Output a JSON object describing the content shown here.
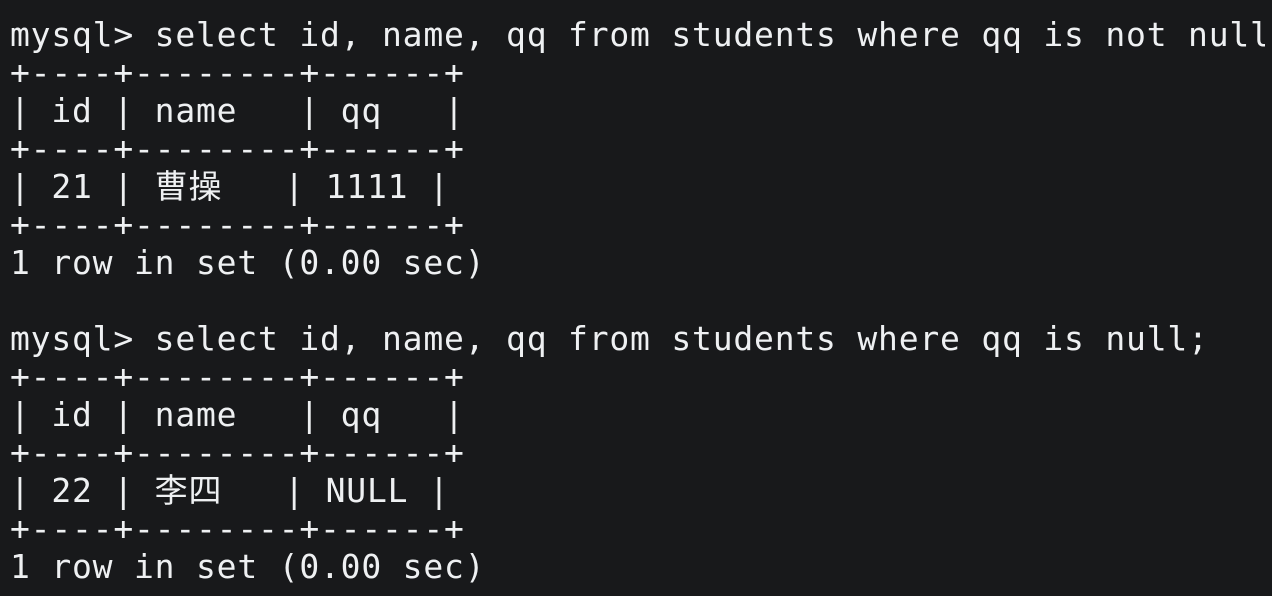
{
  "session": {
    "blocks": [
      {
        "prompt": "mysql> select id, name, qq from students where qq is not null;",
        "border_top": "+----+--------+------+",
        "header_row": "| id | name   | qq   |",
        "border_mid": "+----+--------+------+",
        "data_row": "| 21 | 曹操   | 1111 |",
        "border_bottom": "+----+--------+------+",
        "result": "1 row in set (0.00 sec)"
      },
      {
        "prompt": "mysql> select id, name, qq from students where qq is null;",
        "border_top": "+----+--------+------+",
        "header_row": "| id | name   | qq   |",
        "border_mid": "+----+--------+------+",
        "data_row": "| 22 | 李四   | NULL |",
        "border_bottom": "+----+--------+------+",
        "result": "1 row in set (0.00 sec)"
      }
    ]
  },
  "colors": {
    "background": "#18191b",
    "text": "#eef0f2"
  }
}
